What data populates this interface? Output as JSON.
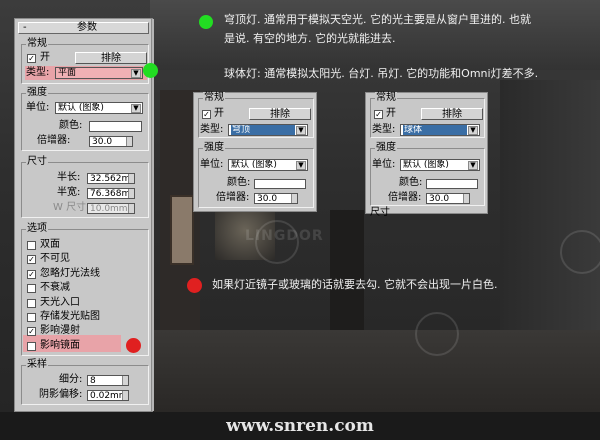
{
  "main_panel": {
    "header_title": "参数",
    "header_collapse": "-",
    "general": {
      "title": "常规",
      "on_label": "开",
      "on_checked": true,
      "exclude_label": "排除",
      "type_label": "类型:",
      "type_value": "平面"
    },
    "intensity": {
      "title": "强度",
      "unit_label": "单位:",
      "unit_value": "默认 (图象)",
      "color_label": "颜色:",
      "multiplier_label": "倍增器:",
      "multiplier_value": "30.0"
    },
    "size": {
      "title": "尺寸",
      "half_length_label": "半长:",
      "half_length_value": "32.562mm",
      "half_width_label": "半宽:",
      "half_width_value": "76.368mm",
      "w_size_label": "W 尺寸",
      "w_size_value": "10.0mm"
    },
    "options": {
      "title": "选项",
      "items": [
        {
          "label": "双面",
          "checked": false
        },
        {
          "label": "不可见",
          "checked": true
        },
        {
          "label": "忽略灯光法线",
          "checked": true
        },
        {
          "label": "不衰减",
          "checked": false
        },
        {
          "label": "天光入口",
          "checked": false
        },
        {
          "label": "存储发光贴图",
          "checked": false
        },
        {
          "label": "影响漫射",
          "checked": true
        },
        {
          "label": "影响镜面",
          "checked": false
        }
      ]
    },
    "sampling": {
      "title": "采样",
      "subdiv_label": "细分:",
      "subdiv_value": "8",
      "shadow_bias_label": "阴影偏移:",
      "shadow_bias_value": "0.02mm"
    }
  },
  "dome_panel": {
    "general_title": "常规",
    "on_label": "开",
    "exclude_label": "排除",
    "type_label": "类型:",
    "type_value": "穹顶",
    "intensity_title": "强度",
    "unit_label": "单位:",
    "unit_value": "默认 (图象)",
    "color_label": "颜色:",
    "multiplier_label": "倍增器:",
    "multiplier_value": "30.0"
  },
  "sphere_panel": {
    "general_title": "常规",
    "on_label": "开",
    "exclude_label": "排除",
    "type_label": "类型:",
    "type_value": "球体",
    "intensity_title": "强度",
    "unit_label": "单位:",
    "unit_value": "默认 (图象)",
    "color_label": "颜色:",
    "multiplier_label": "倍增器:",
    "multiplier_value": "30.0",
    "size_title": "尺寸"
  },
  "notes": {
    "dome_note_line1": "穹顶灯. 通常用于模拟天空光. 它的光主要是从窗户里进的. 也就",
    "dome_note_line2": "是说. 有空的地方. 它的光就能进去.",
    "sphere_note": "球体灯: 通常模拟太阳光. 台灯. 吊灯. 它的功能和Omni灯差不多.",
    "mirror_note": "如果灯近镜子或玻璃的话就要去勾. 它就不会出现一片白色."
  },
  "watermark_text": "LINGDOR",
  "footer": "www.snren.com",
  "colors": {
    "highlight": "#e8a3a8",
    "green_dot": "#22dd22",
    "red_dot": "#e02020",
    "panel_bg": "#c8c8c8",
    "selection_blue": "#3a6ea5"
  }
}
